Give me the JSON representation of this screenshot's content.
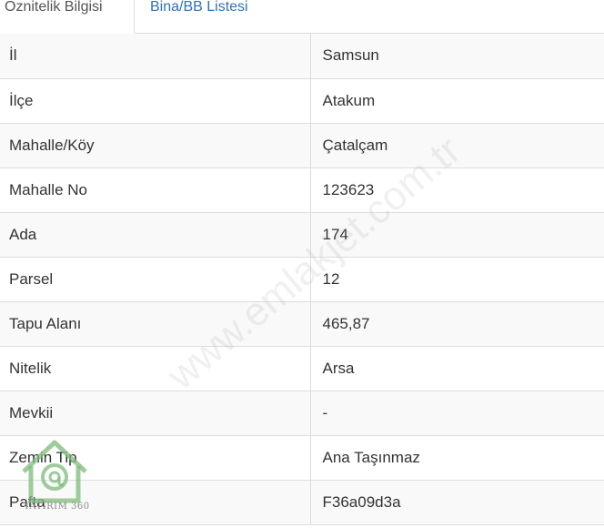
{
  "tabs": [
    {
      "label": "Öznitelik Bilgisi",
      "active": true
    },
    {
      "label": "Bina/BB Listesi",
      "active": false
    }
  ],
  "rows": [
    {
      "label": "İl",
      "value": "Samsun"
    },
    {
      "label": "İlçe",
      "value": "Atakum"
    },
    {
      "label": "Mahalle/Köy",
      "value": "Çatalçam"
    },
    {
      "label": "Mahalle No",
      "value": "123623"
    },
    {
      "label": "Ada",
      "value": "174"
    },
    {
      "label": "Parsel",
      "value": "12"
    },
    {
      "label": "Tapu Alanı",
      "value": "465,87"
    },
    {
      "label": "Nitelik",
      "value": "Arsa"
    },
    {
      "label": "Mevkii",
      "value": "-"
    },
    {
      "label": "Zemin Tip",
      "value": "Ana Taşınmaz"
    },
    {
      "label": "Pafta",
      "value": "F36a09d3a"
    }
  ],
  "watermark": {
    "text": "www.emlakjet.com.tr"
  },
  "logo": {
    "text": "YATIRIM 360",
    "color": "#7dbb7a"
  },
  "colors": {
    "link": "#2f73b5",
    "border": "#dddddd",
    "stripe": "#f9f9f9"
  }
}
